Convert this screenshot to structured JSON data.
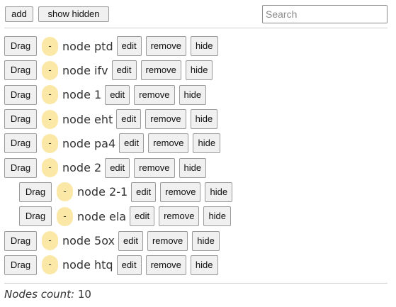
{
  "toolbar": {
    "add_label": "add",
    "show_hidden_label": "show hidden",
    "search_placeholder": "Search",
    "search_value": ""
  },
  "row_buttons": {
    "drag_label": "Drag",
    "toggle_label": "-",
    "edit_label": "edit",
    "remove_label": "remove",
    "hide_label": "hide"
  },
  "nodes": [
    {
      "label": "node ptd",
      "level": 0
    },
    {
      "label": "node ifv",
      "level": 0
    },
    {
      "label": "node 1",
      "level": 0
    },
    {
      "label": "node eht",
      "level": 0
    },
    {
      "label": "node pa4",
      "level": 0
    },
    {
      "label": "node 2",
      "level": 0
    },
    {
      "label": "node 2-1",
      "level": 1
    },
    {
      "label": "node ela",
      "level": 1
    },
    {
      "label": "node 5ox",
      "level": 0
    },
    {
      "label": "node htq",
      "level": 0
    }
  ],
  "footer": {
    "count_label": "Nodes count:",
    "count_value": "10"
  },
  "colors": {
    "toggle_bg": "#fbe8a6",
    "button_bg": "#f0f0f0",
    "divider": "#cfcfcf"
  }
}
